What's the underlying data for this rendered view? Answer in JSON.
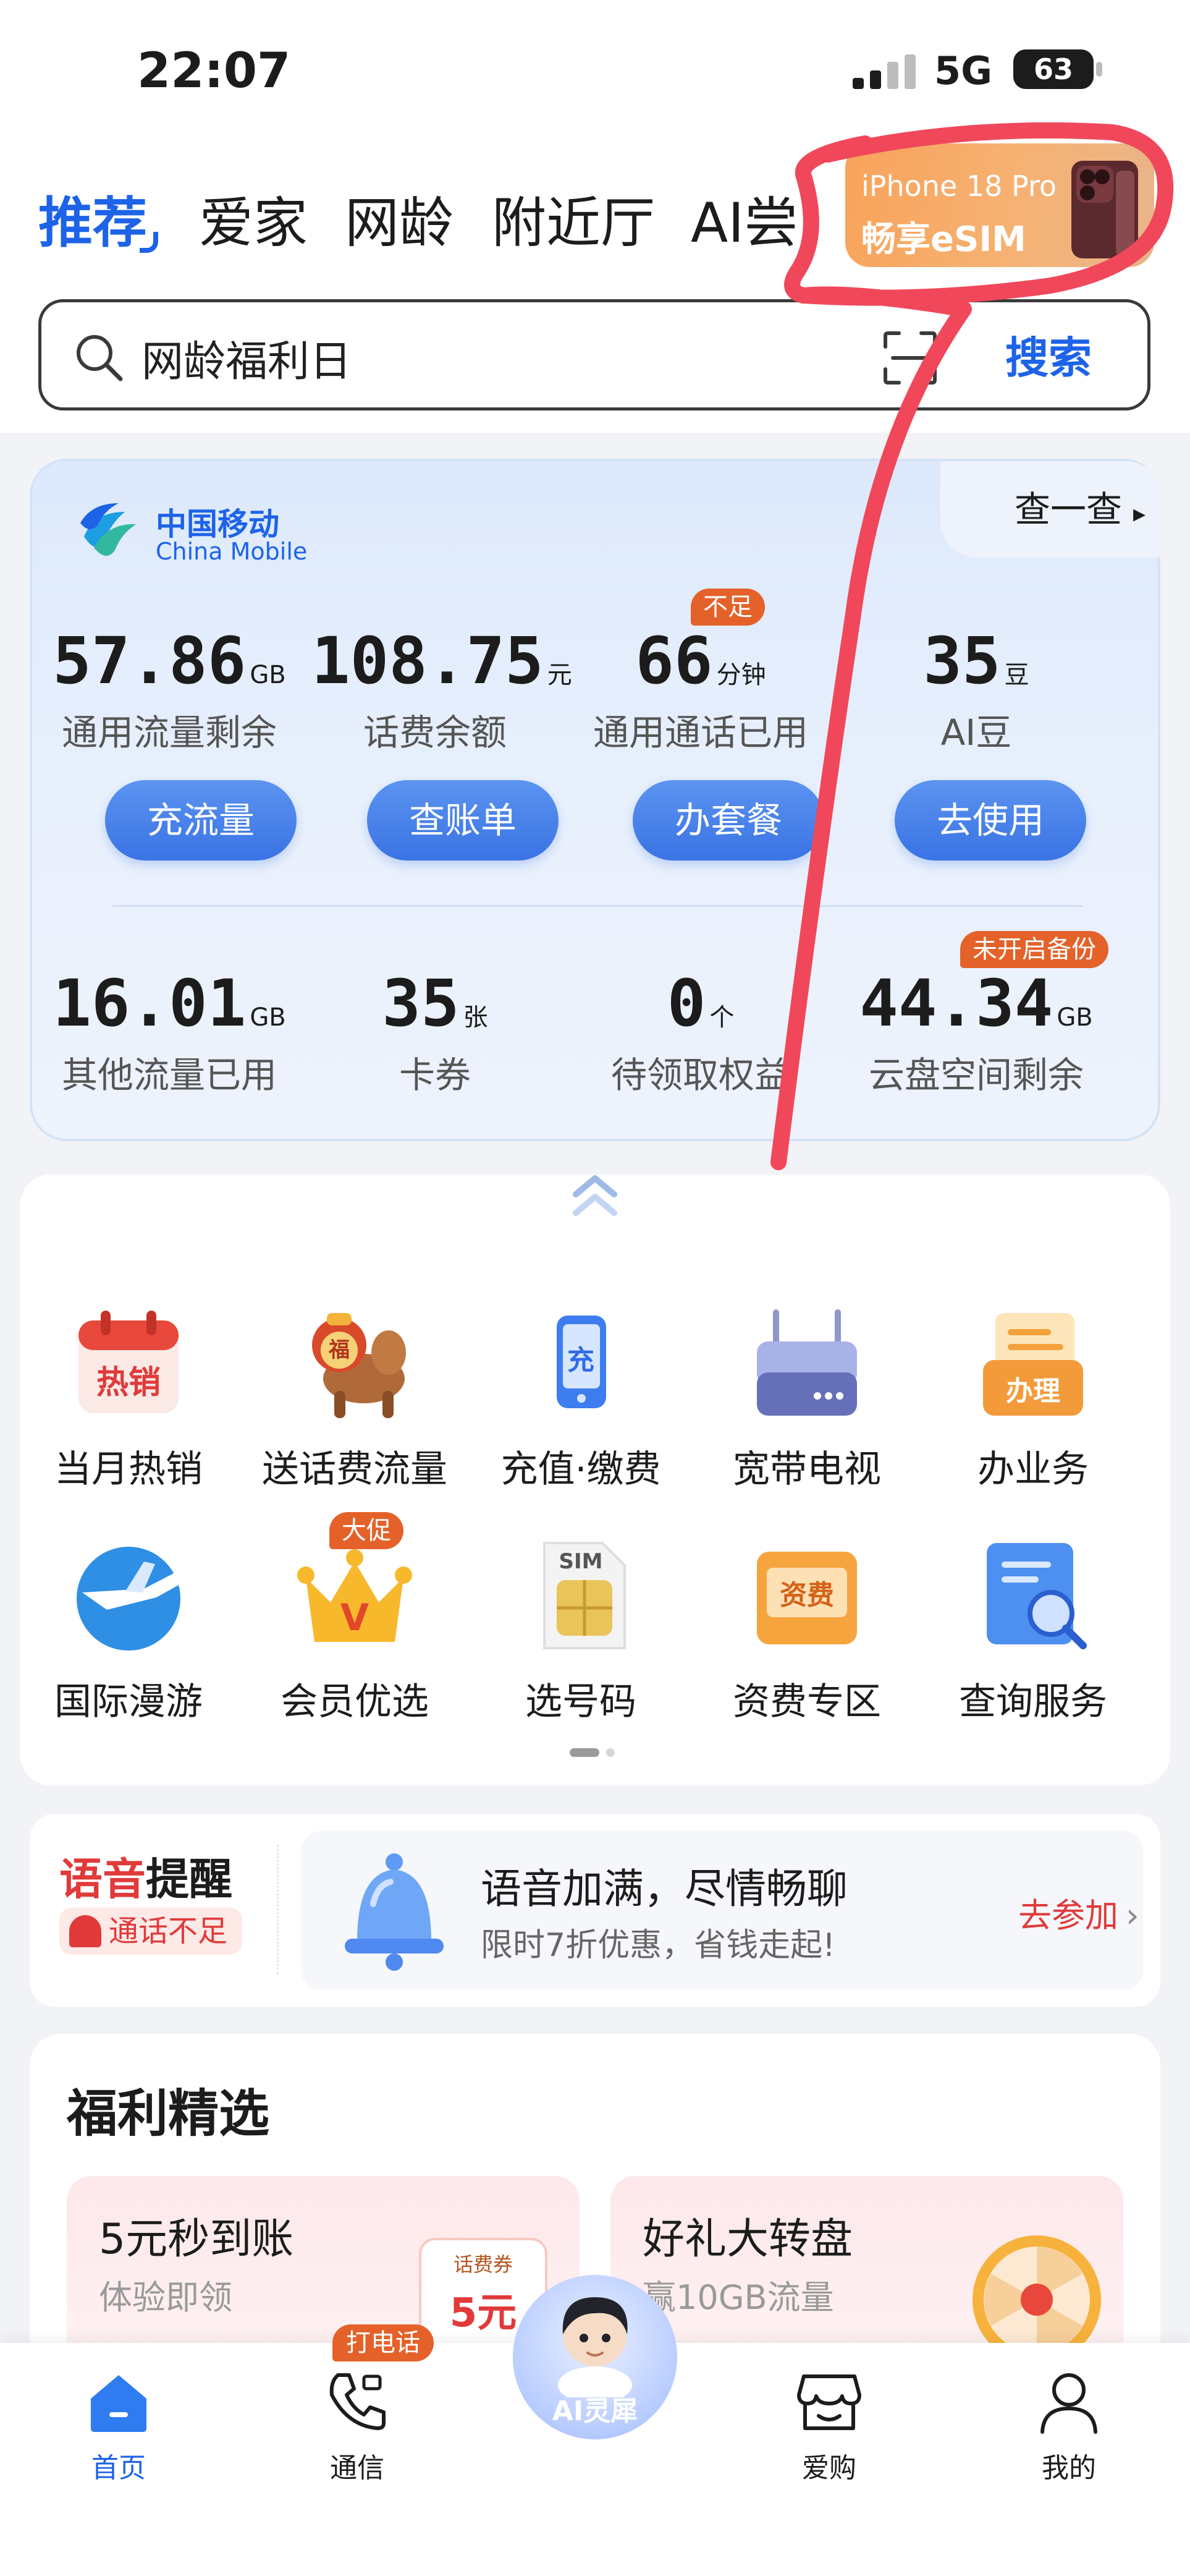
{
  "status_bar": {
    "time": "22:07",
    "network": "5G",
    "battery": "63"
  },
  "tabs": [
    {
      "label": "推荐"
    },
    {
      "label": "爱家"
    },
    {
      "label": "网龄"
    },
    {
      "label": "附近厅"
    },
    {
      "label": "AI尝"
    }
  ],
  "promo": {
    "title": "iPhone 18 Pro",
    "subtitle": "畅享eSIM"
  },
  "search": {
    "value": "网龄福利日",
    "button": "搜索"
  },
  "account": {
    "brand_cn": "中国移动",
    "brand_en": "China Mobile",
    "check_label": "查一查",
    "stats_top": [
      {
        "value": "57.86",
        "unit": "GB",
        "label": "通用流量剩余",
        "action": "充流量"
      },
      {
        "value": "108.75",
        "unit": "元",
        "label": "话费余额",
        "action": "查账单"
      },
      {
        "value": "66",
        "unit": "分钟",
        "label": "通用通话已用",
        "action": "办套餐",
        "badge": "不足"
      },
      {
        "value": "35",
        "unit": "豆",
        "label": "AI豆",
        "action": "去使用"
      }
    ],
    "stats_bottom": [
      {
        "value": "16.01",
        "unit": "GB",
        "label": "其他流量已用"
      },
      {
        "value": "35",
        "unit": "张",
        "label": "卡券"
      },
      {
        "value": "0",
        "unit": "个",
        "label": "待领取权益"
      },
      {
        "value": "44.34",
        "unit": "GB",
        "label": "云盘空间剩余",
        "badge": "未开启备份"
      }
    ]
  },
  "services": [
    {
      "label": "当月热销",
      "icon": "hot-sale-calendar-icon",
      "icon_text": "热销"
    },
    {
      "label": "送话费流量",
      "icon": "horse-gift-icon",
      "icon_text": "福"
    },
    {
      "label": "充值·缴费",
      "icon": "phone-recharge-icon",
      "icon_text": "充"
    },
    {
      "label": "宽带电视",
      "icon": "router-icon",
      "icon_text": ""
    },
    {
      "label": "办业务",
      "icon": "business-folder-icon",
      "icon_text": "办理"
    },
    {
      "label": "国际漫游",
      "icon": "airplane-globe-icon",
      "icon_text": ""
    },
    {
      "label": "会员优选",
      "icon": "crown-icon",
      "icon_text": "V",
      "badge": "大促"
    },
    {
      "label": "选号码",
      "icon": "sim-card-icon",
      "icon_text": "SIM"
    },
    {
      "label": "资费专区",
      "icon": "tariff-folder-icon",
      "icon_text": "资费"
    },
    {
      "label": "查询服务",
      "icon": "query-magnifier-icon",
      "icon_text": ""
    }
  ],
  "voice": {
    "title_a": "语音",
    "title_b": "提醒",
    "badge": "通话不足",
    "headline": "语音加满，尽情畅聊",
    "desc": "限时7折优惠，省钱走起!",
    "join": "去参加"
  },
  "welfare": {
    "title": "福利精选",
    "cards": [
      {
        "title": "5元秒到账",
        "subtitle": "体验即领",
        "coupon_label": "话费券",
        "coupon_value": "5元"
      },
      {
        "title": "好礼大转盘",
        "subtitle": "赢10GB流量"
      }
    ]
  },
  "bottom_nav": {
    "items": [
      {
        "label": "首页"
      },
      {
        "label": "通信",
        "badge": "打电话"
      },
      {
        "label": "AI灵犀"
      },
      {
        "label": "爱购"
      },
      {
        "label": "我的"
      }
    ]
  },
  "colors": {
    "accent": "#1d63e8",
    "alert": "#e4622a",
    "annotation": "#f0485a"
  }
}
